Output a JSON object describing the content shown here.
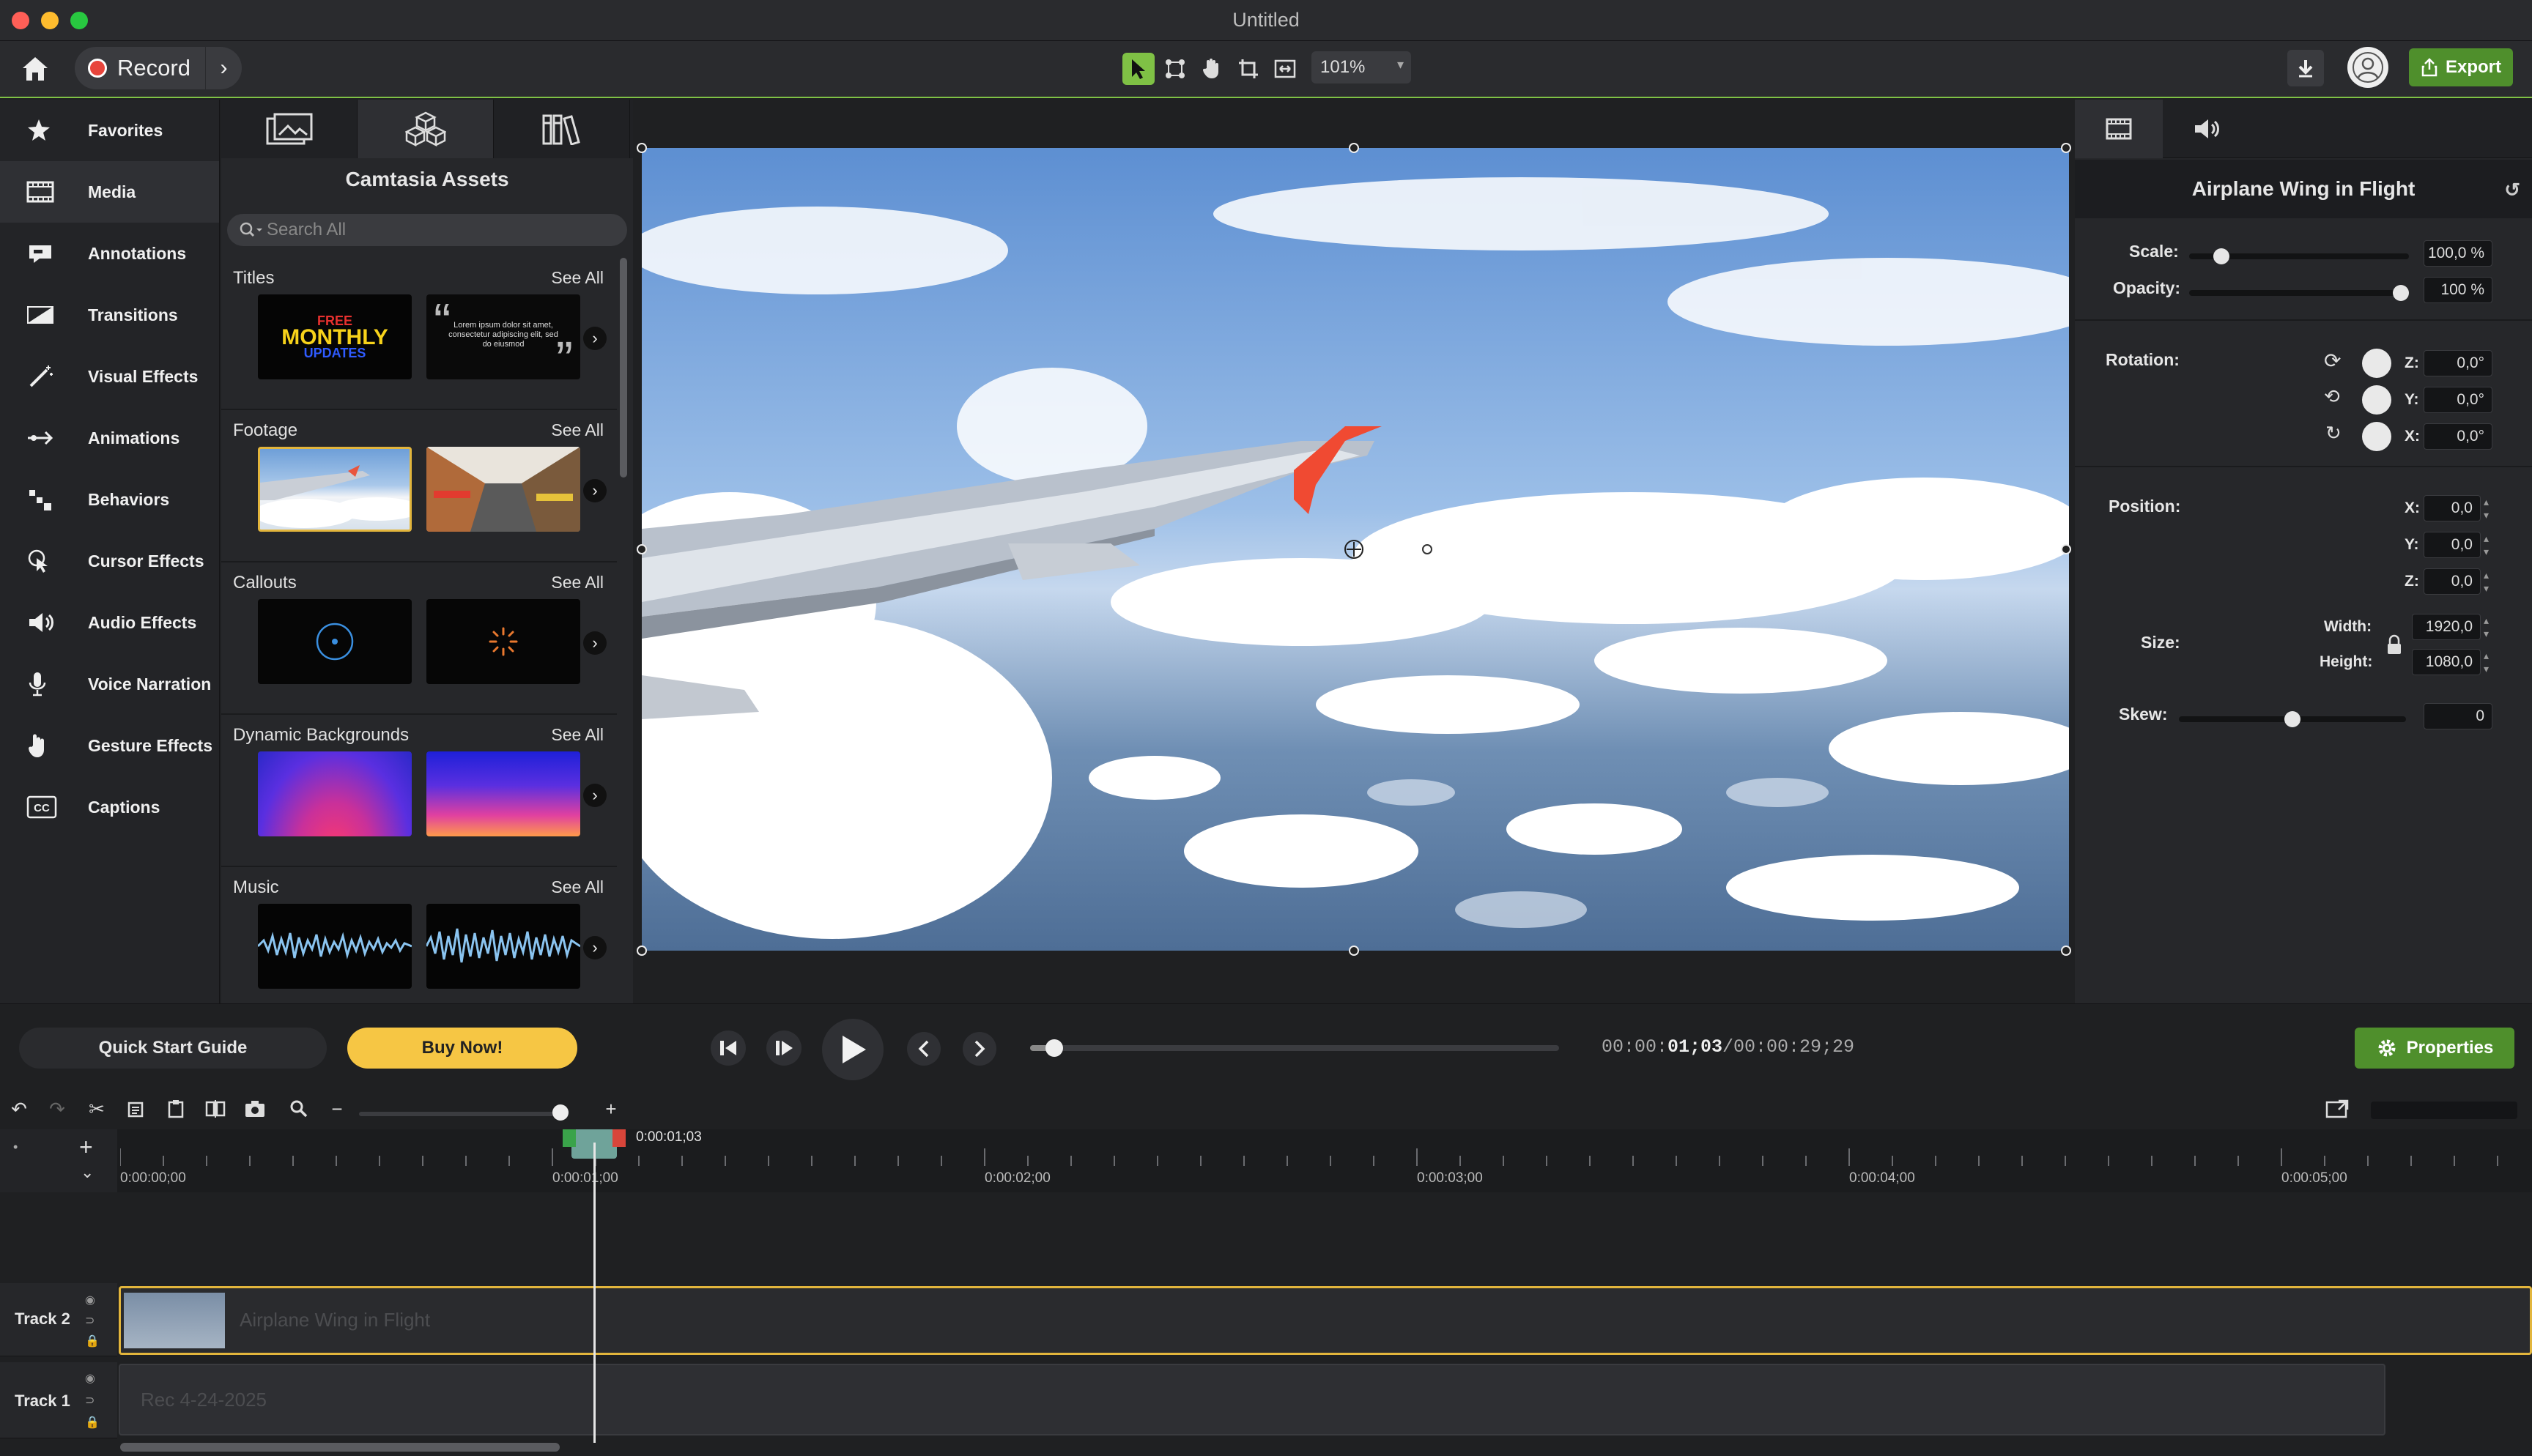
{
  "window": {
    "title": "Untitled"
  },
  "toolbar": {
    "record_label": "Record",
    "zoom_value": "101%",
    "export_label": "Export"
  },
  "leftnav": {
    "items": [
      {
        "label": "Favorites",
        "icon": "star-icon"
      },
      {
        "label": "Media",
        "icon": "film-icon"
      },
      {
        "label": "Annotations",
        "icon": "annotation-icon"
      },
      {
        "label": "Transitions",
        "icon": "transition-icon"
      },
      {
        "label": "Visual Effects",
        "icon": "magic-wand-icon"
      },
      {
        "label": "Animations",
        "icon": "animation-arrow-icon"
      },
      {
        "label": "Behaviors",
        "icon": "behaviors-icon"
      },
      {
        "label": "Cursor Effects",
        "icon": "cursor-icon"
      },
      {
        "label": "Audio Effects",
        "icon": "speaker-icon"
      },
      {
        "label": "Voice Narration",
        "icon": "microphone-icon"
      },
      {
        "label": "Gesture Effects",
        "icon": "hand-icon"
      },
      {
        "label": "Captions",
        "icon": "cc-icon"
      }
    ]
  },
  "assets": {
    "title": "Camtasia Assets",
    "search_placeholder": "Search All",
    "see_all": "See All",
    "sections": [
      {
        "title": "Titles"
      },
      {
        "title": "Footage"
      },
      {
        "title": "Callouts"
      },
      {
        "title": "Dynamic Backgrounds"
      },
      {
        "title": "Music"
      }
    ],
    "title_thumb_line1": "FREE",
    "title_thumb_line2": "MONTHLY",
    "title_thumb_line3": "UPDATES",
    "title_thumb2_text": "Lorem ipsum dolor sit amet, consectetur adipiscing elit, sed do eiusmod"
  },
  "properties": {
    "title": "Airplane Wing in Flight",
    "scale_label": "Scale:",
    "scale_value": "100,0 %",
    "scale_level": 0.12,
    "opacity_label": "Opacity:",
    "opacity_value": "100 %",
    "opacity_level": 1.0,
    "rotation_label": "Rotation:",
    "rot_z": "0,0°",
    "rot_y": "0,0°",
    "rot_x": "0,0°",
    "position_label": "Position:",
    "pos_x": "0,0",
    "pos_y": "0,0",
    "pos_z": "0,0",
    "size_label": "Size:",
    "width_label": "Width:",
    "width_value": "1920,0",
    "height_label": "Height:",
    "height_value": "1080,0",
    "skew_label": "Skew:",
    "skew_value": "0",
    "skew_level": 0.5,
    "axis_z": "Z:",
    "axis_y": "Y:",
    "axis_x": "X:"
  },
  "playback": {
    "quick_start_label": "Quick Start Guide",
    "buy_label": "Buy Now!",
    "time_prefix": "00:00:",
    "time_current": "01;03",
    "time_total": "/00:00:29;29",
    "progress": 0.035,
    "properties_label": "Properties"
  },
  "timeline": {
    "playhead_label": "0:00:01;03",
    "ruler_labels": [
      "0:00:00;00",
      "0:00:01;00",
      "0:00:02;00",
      "0:00:03;00",
      "0:00:04;00",
      "0:00:05;00"
    ],
    "tracks": [
      {
        "name": "Track 2",
        "clip": "Airplane Wing in Flight"
      },
      {
        "name": "Track 1",
        "clip": "Rec 4-24-2025"
      }
    ]
  },
  "colors": {
    "accent": "#7fc145",
    "buy": "#f6c644",
    "record": "#e8453c"
  }
}
